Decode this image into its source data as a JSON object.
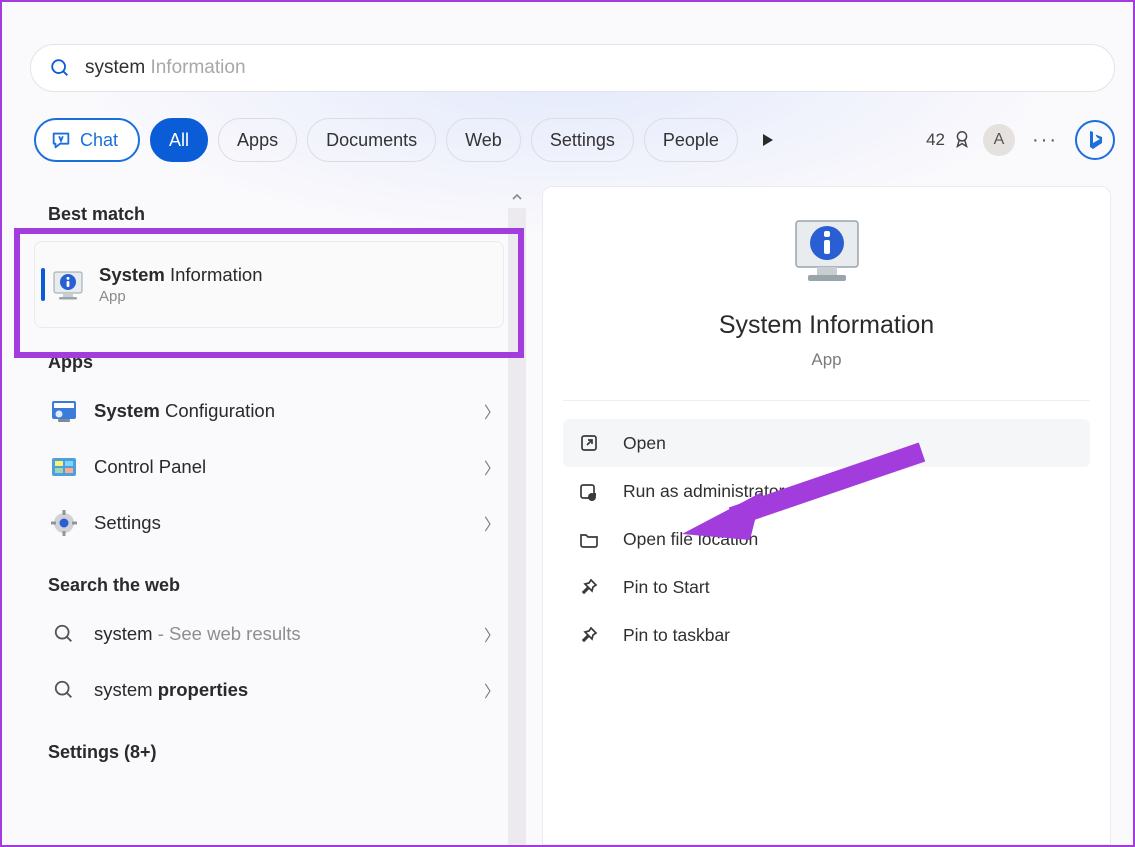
{
  "search": {
    "typed": "system",
    "suggestion": " Information"
  },
  "filters": {
    "chat": "Chat",
    "all": "All",
    "apps": "Apps",
    "documents": "Documents",
    "web": "Web",
    "settings": "Settings",
    "people": "People"
  },
  "header": {
    "points": "42",
    "avatar_letter": "A"
  },
  "left": {
    "best_match_hdr": "Best match",
    "best": {
      "bold": "System",
      "rest": " Information",
      "sub": "App"
    },
    "apps_hdr": "Apps",
    "apps": [
      {
        "bold": "System",
        "rest": " Configuration"
      },
      {
        "bold": "",
        "rest": "Control Panel"
      },
      {
        "bold": "",
        "rest": "Settings"
      }
    ],
    "web_hdr": "Search the web",
    "web": [
      {
        "bold": "",
        "rest": "system",
        "tail": " - See web results"
      },
      {
        "pre": "system ",
        "bold": "properties",
        "rest": ""
      }
    ],
    "settings_hdr": "Settings (8+)"
  },
  "right": {
    "title": "System Information",
    "sub": "App",
    "actions": {
      "open": "Open",
      "run_admin": "Run as administrator",
      "open_loc": "Open file location",
      "pin_start": "Pin to Start",
      "pin_task": "Pin to taskbar"
    }
  }
}
